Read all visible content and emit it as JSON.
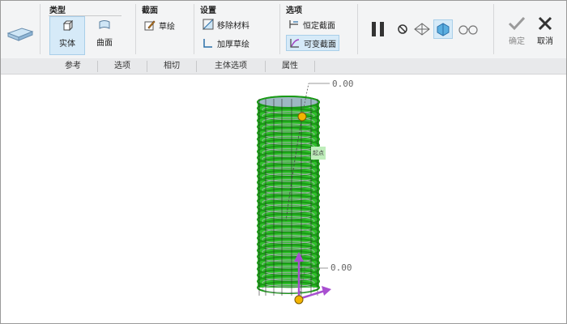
{
  "groups": {
    "type": {
      "title": "类型",
      "solid_label": "实体",
      "surface_label": "曲面"
    },
    "section": {
      "title": "截面",
      "sketch_label": "草绘"
    },
    "settings": {
      "title": "设置",
      "remove_material_label": "移除材料",
      "thicken_sketch_label": "加厚草绘"
    },
    "options": {
      "title": "选项",
      "constant_section_label": "恒定截面",
      "variable_section_label": "可变截面"
    }
  },
  "actions": {
    "ok_label": "确定",
    "cancel_label": "取消"
  },
  "tabs": [
    "参考",
    "选项",
    "相切",
    "主体选项",
    "属性"
  ],
  "canvas": {
    "dim_top": "0.00",
    "dim_bottom": "0.00",
    "start_point_label": "起点"
  },
  "colors": {
    "accent": "#2a9fd8",
    "model_green": "#22c21e",
    "csys_purple": "#a84fd0",
    "point_yellow": "#f4b400"
  }
}
